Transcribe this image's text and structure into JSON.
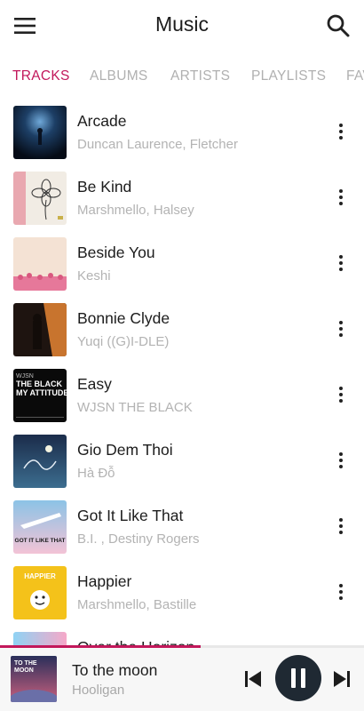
{
  "app_bar": {
    "title": "Music",
    "menu_icon": "menu-icon",
    "search_icon": "search-icon"
  },
  "tabs": [
    {
      "label": "TRACKS",
      "active": true
    },
    {
      "label": "ALBUMS",
      "active": false
    },
    {
      "label": "ARTISTS",
      "active": false
    },
    {
      "label": "PLAYLISTS",
      "active": false
    },
    {
      "label": "FAVORITES",
      "active": false
    }
  ],
  "accent_color": "#c2185b",
  "tracks": [
    {
      "title": "Arcade",
      "artist": "Duncan Laurence,  Fletcher"
    },
    {
      "title": "Be Kind",
      "artist": "Marshmello,  Halsey"
    },
    {
      "title": "Beside You",
      "artist": "Keshi"
    },
    {
      "title": "Bonnie Clyde",
      "artist": "Yuqi ((G)I-DLE)"
    },
    {
      "title": "Easy",
      "artist": "WJSN THE BLACK"
    },
    {
      "title": "Gio Dem Thoi",
      "artist": "Hà Đỗ"
    },
    {
      "title": "Got It Like That",
      "artist": "B.I. ,    Destiny Rogers"
    },
    {
      "title": "Happier",
      "artist": "Marshmello, Bastille"
    },
    {
      "title": "Over the Horizon",
      "artist": ""
    }
  ],
  "artwork_text": {
    "easy_1": "WJSN",
    "easy_2": "THE BLACK",
    "easy_3": "MY ATTITUDE",
    "got_it": "GOT IT LIKE THAT",
    "happier": "HAPPIER",
    "moon_1": "TO THE",
    "moon_2": "MOON"
  },
  "now_playing": {
    "title": "To the moon",
    "artist": "Hooligan",
    "progress": 0.55,
    "state": "playing"
  }
}
